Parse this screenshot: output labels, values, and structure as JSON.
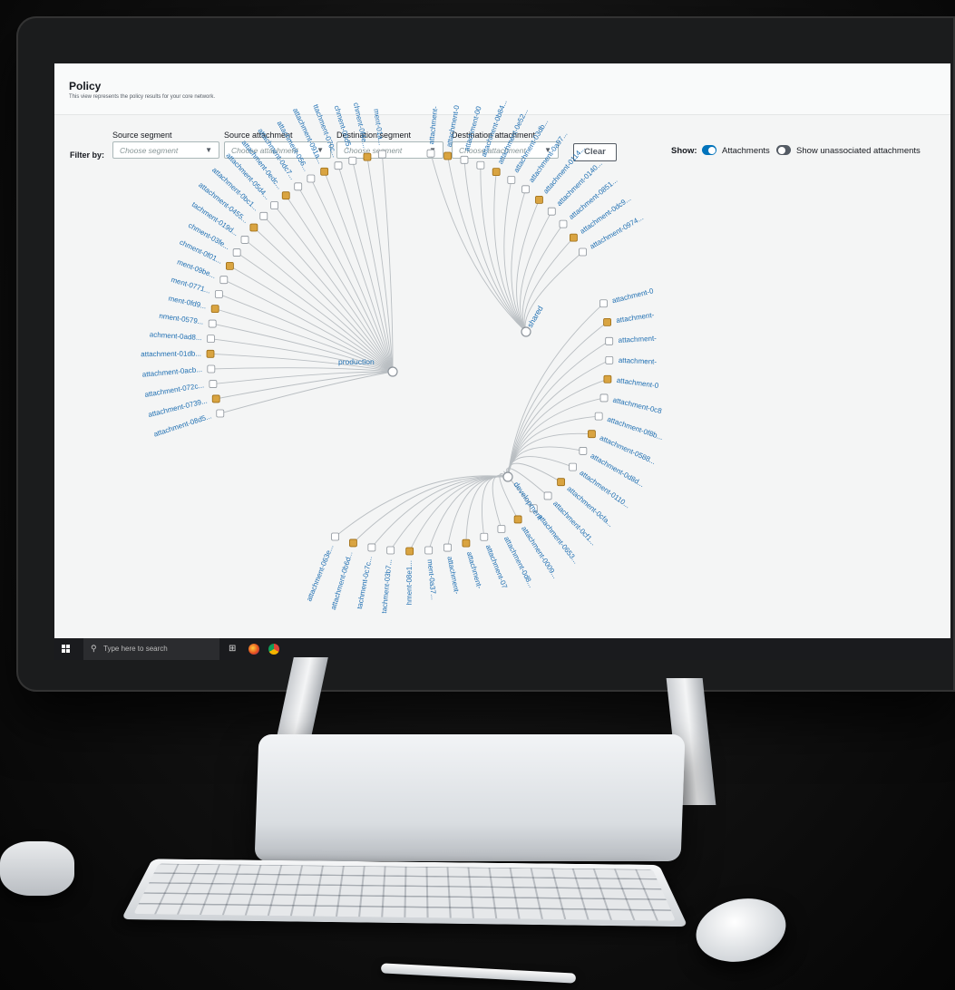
{
  "page": {
    "title": "Policy",
    "subtitle": "This view represents the policy results for your core network."
  },
  "filters": {
    "filter_by_label": "Filter by:",
    "source_segment": {
      "label": "Source segment",
      "placeholder": "Choose segment"
    },
    "source_attachment": {
      "label": "Source attachment",
      "placeholder": "Choose attachment"
    },
    "destination_segment": {
      "label": "Destination segment",
      "placeholder": "Choose segment"
    },
    "destination_attachment": {
      "label": "Destination attachment",
      "placeholder": "Choose attachment"
    },
    "clear_label": "Clear"
  },
  "show": {
    "label": "Show:",
    "attachments": {
      "label": "Attachments",
      "on": true
    },
    "unassociated": {
      "label": "Show unassociated attachments",
      "on": false
    }
  },
  "graph": {
    "segments": [
      {
        "name": "production",
        "attachments": [
          "attachment-08d5...",
          "attachment-0739...",
          "attachment-072c...",
          "attachment-0acb...",
          "attachment-01db...",
          "achment-0ad8...",
          "nment-0579...",
          "ment-0fd9...",
          "ment-0771...",
          "ment-09be...",
          "chment-0f01...",
          "chment-03fe...",
          "tachment-019d...",
          "attachment-0455...",
          "attachment-0bc1...",
          "attachment-05d4...",
          "attachment-0edc...",
          "attachment-0dc7...",
          "attachment-056...",
          "attachment-091a...",
          "ttachment-070c...",
          "chment-00d5...",
          "chment-0f4e...",
          "ment-01a..."
        ]
      },
      {
        "name": "shared",
        "attachments": [
          "attachment-",
          "attachment-0",
          "attachment-00",
          "attachment-0b84...",
          "attachment-0e52...",
          "attachment-03db...",
          "attachment-0a97...",
          "attachment-0114...",
          "attachment-0140...",
          "attachment-0851...",
          "attachment-0dc9...",
          "attachment-0974..."
        ]
      },
      {
        "name": "development",
        "attachments": [
          "attachment-0",
          "attachment-",
          "attachment-",
          "attachment-",
          "attachment-0",
          "attachment-0c8",
          "attachment-0f8b...",
          "attachment-0588...",
          "attachment-0d8d...",
          "attachment-0110...",
          "attachment-0cfa...",
          "attachment-0cf1...",
          "attachment-0653...",
          "attachment-0009...",
          "attachment-0d8...",
          "attachment-07",
          "attachment-",
          "attachment-",
          "ment-0a37...",
          "hment-08e1...",
          "tachment-03b7...",
          "tachment-0c7c...",
          "attachment-0b6d...",
          "attachment-063e..."
        ]
      }
    ]
  },
  "taskbar": {
    "search_placeholder": "Type here to search"
  },
  "colors": {
    "accent": "#0073bb",
    "link": "#1f6fb2",
    "edge": "#b9bec2",
    "node_vpc": "#d9a441",
    "node_other": "#8d949b"
  }
}
